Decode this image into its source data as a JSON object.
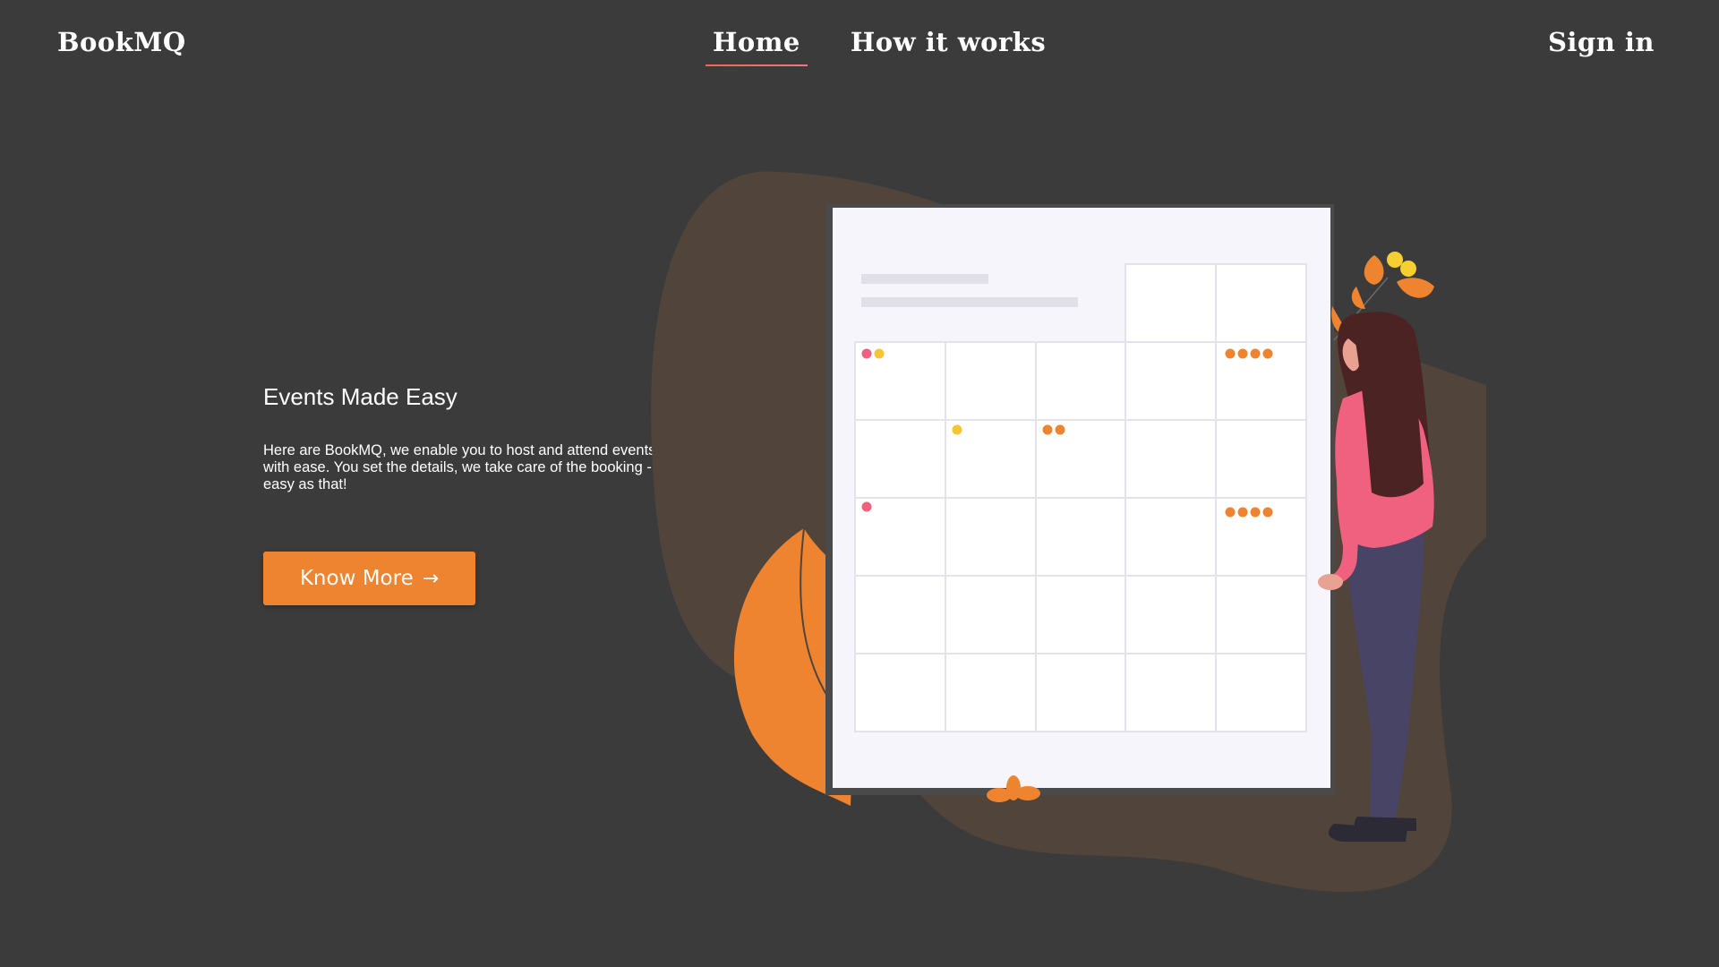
{
  "header": {
    "logo": "BookMQ",
    "nav": [
      {
        "label": "Home",
        "active": true
      },
      {
        "label": "How it works",
        "active": false
      }
    ],
    "sign_in": "Sign in"
  },
  "hero": {
    "title": "Events Made Easy",
    "description": "Here are BookMQ, we enable you to host and attend events with ease. You set the details, we take care of the booking - easy as that!",
    "cta_label": "Know More",
    "cta_icon": "arrow-right-icon"
  },
  "colors": {
    "background": "#3b3b3b",
    "accent": "#ef8430",
    "nav_underline": "#f0738a",
    "blob": "#50443b",
    "card": "#f6f5fb"
  },
  "illustration": {
    "subject": "calendar-board-with-woman",
    "icons": [
      "calendar-board-icon",
      "woman-figure-icon",
      "plant-icon",
      "leaf-icon"
    ]
  }
}
